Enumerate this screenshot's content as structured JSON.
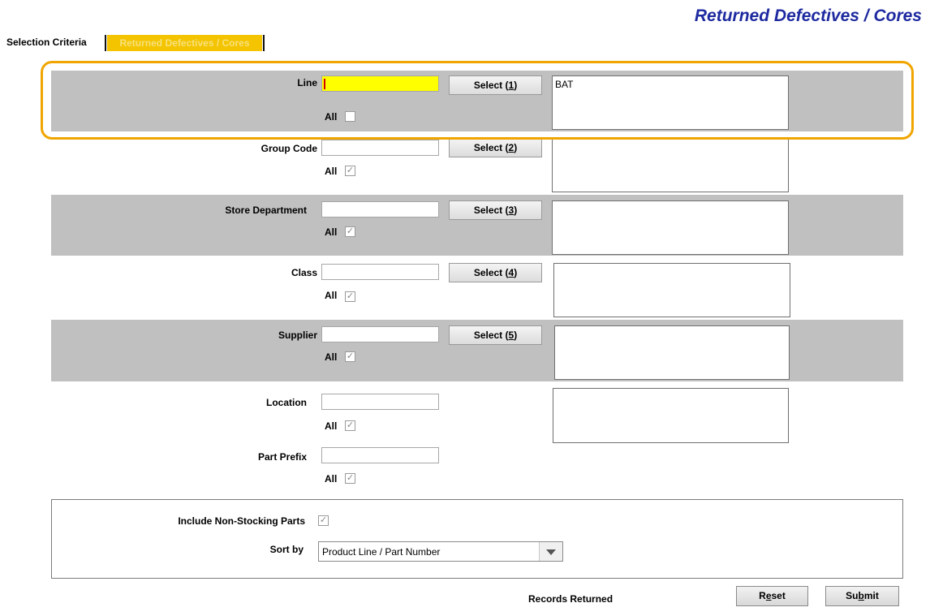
{
  "page_title": "Returned Defectives / Cores",
  "tabs": {
    "selection_criteria": "Selection Criteria",
    "returned_defectives": "Returned Defectives / Cores"
  },
  "criteria": {
    "line": {
      "label": "Line",
      "value": "",
      "select_prefix": "Select (",
      "select_key": "1",
      "select_suffix": ")",
      "all_label": "All",
      "all_checked": false,
      "list": "BAT"
    },
    "group_code": {
      "label": "Group Code",
      "value": "",
      "select_prefix": "Select (",
      "select_key": "2",
      "select_suffix": ")",
      "all_label": "All",
      "all_checked": true,
      "list": ""
    },
    "store_department": {
      "label": "Store Department",
      "value": "",
      "select_prefix": "Select (",
      "select_key": "3",
      "select_suffix": ")",
      "all_label": "All",
      "all_checked": true,
      "list": ""
    },
    "class": {
      "label": "Class",
      "value": "",
      "select_prefix": "Select (",
      "select_key": "4",
      "select_suffix": ")",
      "all_label": "All",
      "all_checked": true,
      "list": ""
    },
    "supplier": {
      "label": "Supplier",
      "value": "",
      "select_prefix": "Select (",
      "select_key": "5",
      "select_suffix": ")",
      "all_label": "All",
      "all_checked": true,
      "list": ""
    },
    "location": {
      "label": "Location",
      "value": "",
      "all_label": "All",
      "all_checked": true,
      "list": ""
    },
    "part_prefix": {
      "label": "Part Prefix",
      "value": "",
      "all_label": "All",
      "all_checked": true
    }
  },
  "options": {
    "include_non_stocking_label": "Include Non-Stocking Parts",
    "include_non_stocking_checked": true,
    "sort_by_label": "Sort by",
    "sort_by_value": "Product Line / Part Number"
  },
  "footer": {
    "records_returned_label": "Records Returned",
    "reset_pre": "R",
    "reset_key": "e",
    "reset_post": "set",
    "submit_pre": "Su",
    "submit_key": "b",
    "submit_post": "mit"
  },
  "colors": {
    "title": "#1e2aa0",
    "tab_active": "#f4c400",
    "band": "#c0c0c0",
    "focus_field": "#ffff00",
    "highlight": "#f0a500"
  },
  "icons": {
    "checkmark": "check-icon",
    "dropdown": "chevron-down-icon"
  }
}
